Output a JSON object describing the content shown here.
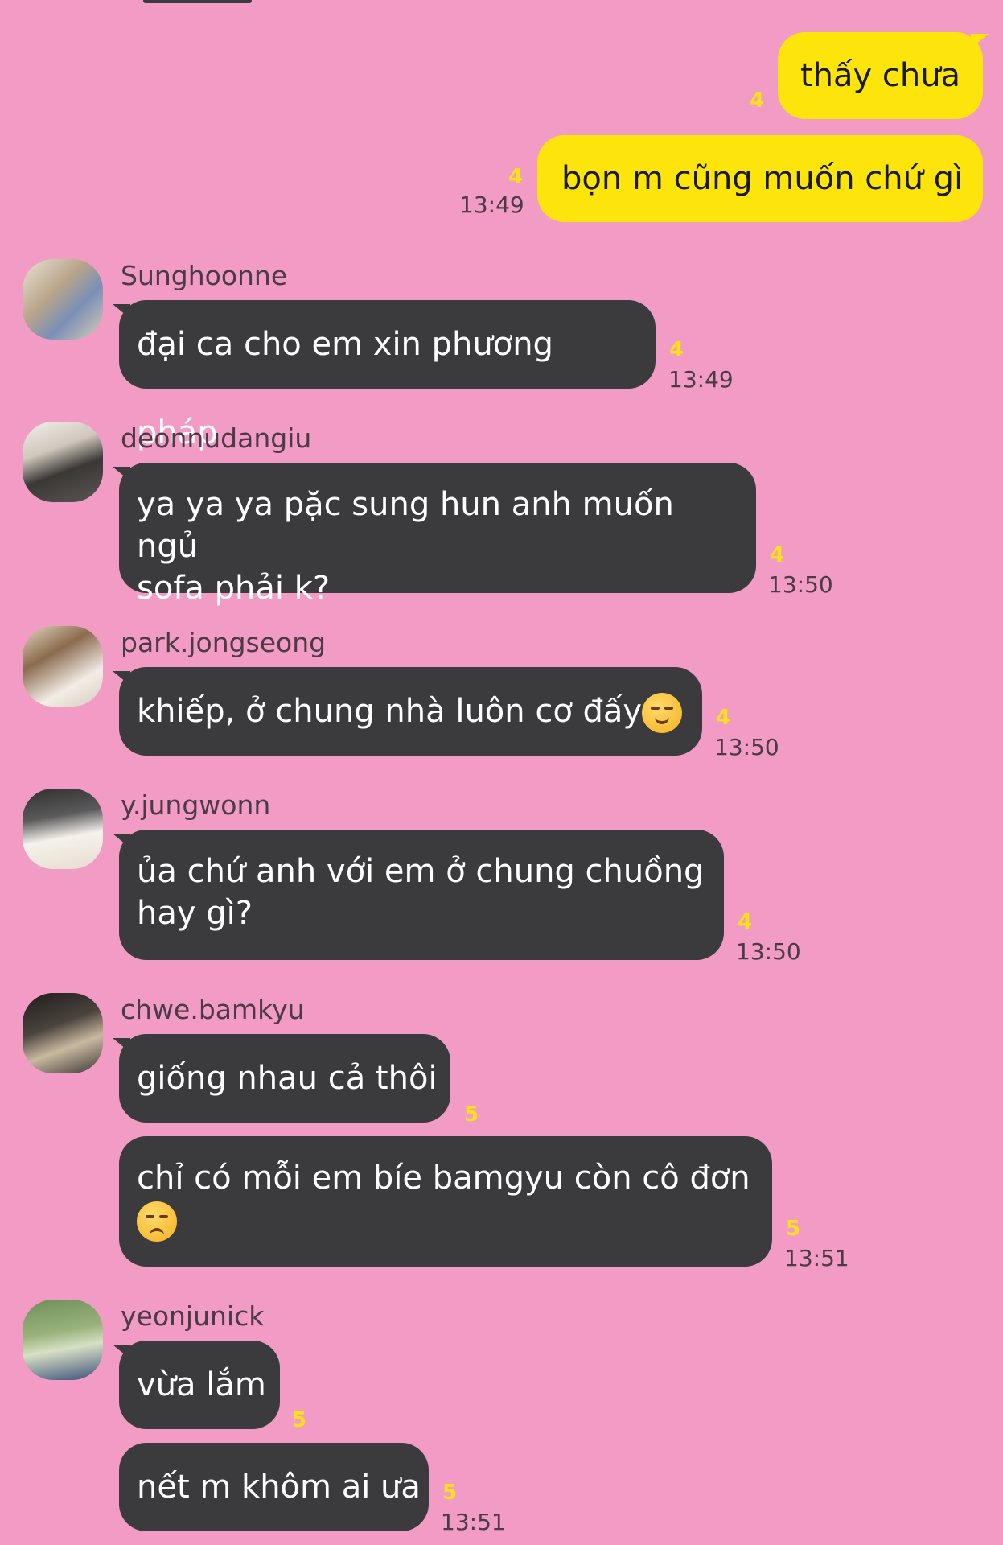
{
  "colors": {
    "background": "#f29bc4",
    "my_bubble": "#fde50c",
    "their_bubble": "#3b3a3d",
    "unread_count": "#f7e21a"
  },
  "messages": {
    "m1": {
      "text": "thấy chưa",
      "count": "4"
    },
    "m2": {
      "text": "bọn m cũng muốn chứ gì",
      "count": "4",
      "time": "13:49"
    },
    "m3": {
      "sender": "Sunghoonne",
      "text": "đại ca cho em xin phương pháp",
      "count": "4",
      "time": "13:49"
    },
    "m4": {
      "sender": "deonnudangiu",
      "line1": "ya ya ya pặc sung hun anh muốn ngủ",
      "line2": "sofa phải k?",
      "count": "4",
      "time": "13:50"
    },
    "m5": {
      "sender": "park.jongseong",
      "text": "khiếp, ở chung nhà luôn cơ đấy",
      "emoji": "smirking-face",
      "count": "4",
      "time": "13:50"
    },
    "m6": {
      "sender": "y.jungwonn",
      "line1": "ủa chứ anh với em ở chung chuồng",
      "line2": "hay gì?",
      "count": "4",
      "time": "13:50"
    },
    "m7": {
      "sender": "chwe.bamkyu",
      "text": "giống nhau cả thôi",
      "count": "5"
    },
    "m8": {
      "line1": "chỉ có mỗi em bíe bamgyu còn cô đơn",
      "emoji": "disappointed-face",
      "count": "5",
      "time": "13:51"
    },
    "m9": {
      "sender": "yeonjunick",
      "text": "vừa lắm",
      "count": "5"
    },
    "m10": {
      "text": "nết m khôm ai ưa",
      "count": "5",
      "time": "13:51"
    }
  }
}
